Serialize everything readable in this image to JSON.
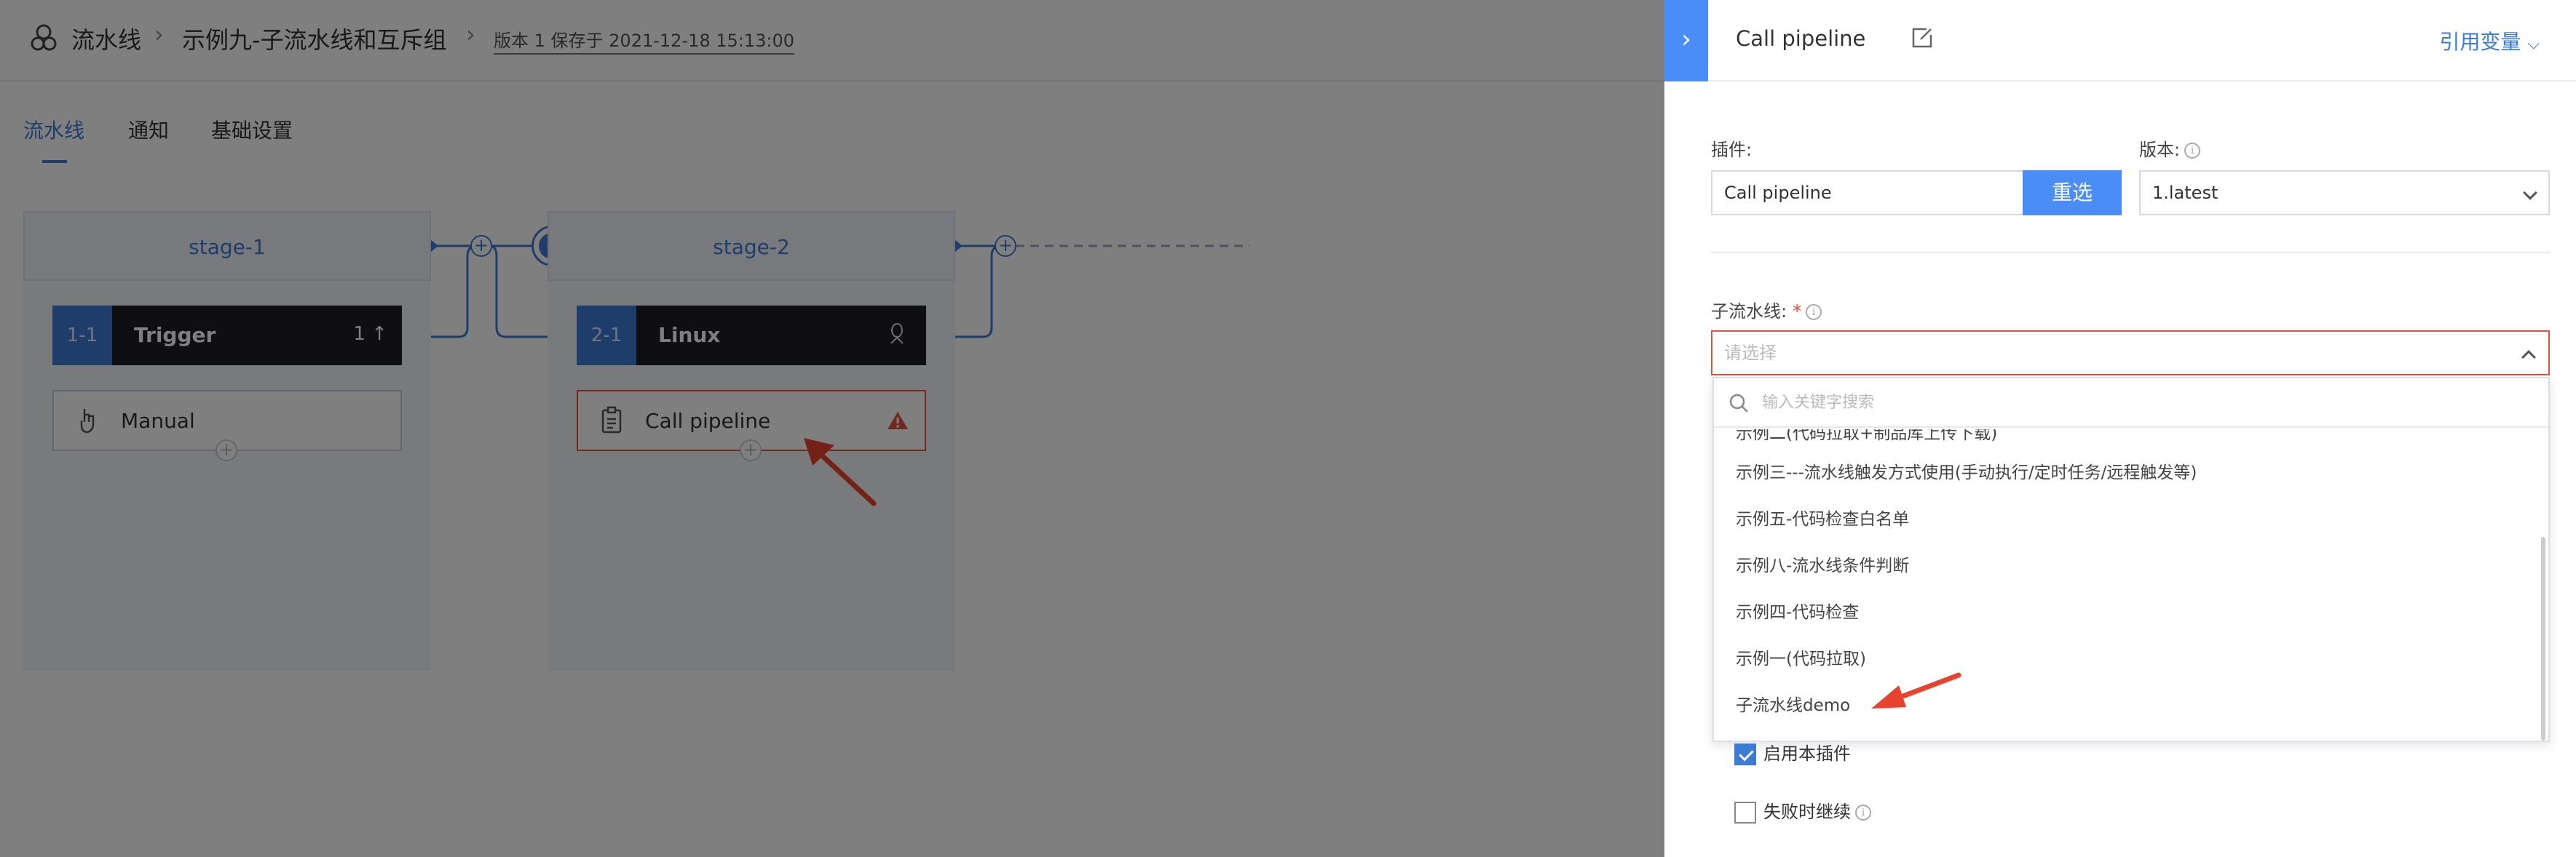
{
  "breadcrumb": {
    "root": "流水线",
    "pipeline": "示例九-子流水线和互斥组",
    "version": "版本 1 保存于 2021-12-18 15:13:00"
  },
  "tabs": [
    {
      "label": "流水线",
      "active": true
    },
    {
      "label": "通知",
      "active": false
    },
    {
      "label": "基础设置",
      "active": false
    }
  ],
  "stages": [
    {
      "name": "stage-1",
      "job": {
        "num": "1-1",
        "name": "Trigger",
        "extra": "1"
      },
      "task": {
        "name": "Manual",
        "error": false
      }
    },
    {
      "name": "stage-2",
      "job": {
        "num": "2-1",
        "name": "Linux",
        "extra": ""
      },
      "task": {
        "name": "Call pipeline",
        "error": true
      }
    }
  ],
  "panel": {
    "title": "Call pipeline",
    "ref_variables": "引用变量",
    "plugin_label": "插件:",
    "plugin_value": "Call pipeline",
    "reselect": "重选",
    "version_label": "版本:",
    "version_value": "1.latest",
    "sub_pipeline_label": "子流水线:",
    "sub_pipeline_placeholder": "请选择",
    "search_placeholder": "输入关键字搜索",
    "options": [
      "示例二(代码拉取+制品库上传下载)",
      "示例三---流水线触发方式使用(手动执行/定时任务/远程触发等)",
      "示例五-代码检查白名单",
      "示例八-流水线条件判断",
      "示例四-代码检查",
      "示例一(代码拉取)",
      "子流水线demo"
    ],
    "enable_plugin": "启用本插件",
    "enable_checked": true,
    "continue_on_fail": "失败时继续",
    "continue_checked": false
  },
  "colors": {
    "accent": "#3c7bd6",
    "primary_button": "#4a8df7",
    "error": "#e0523d",
    "annotation_arrow": "#e8432e"
  }
}
